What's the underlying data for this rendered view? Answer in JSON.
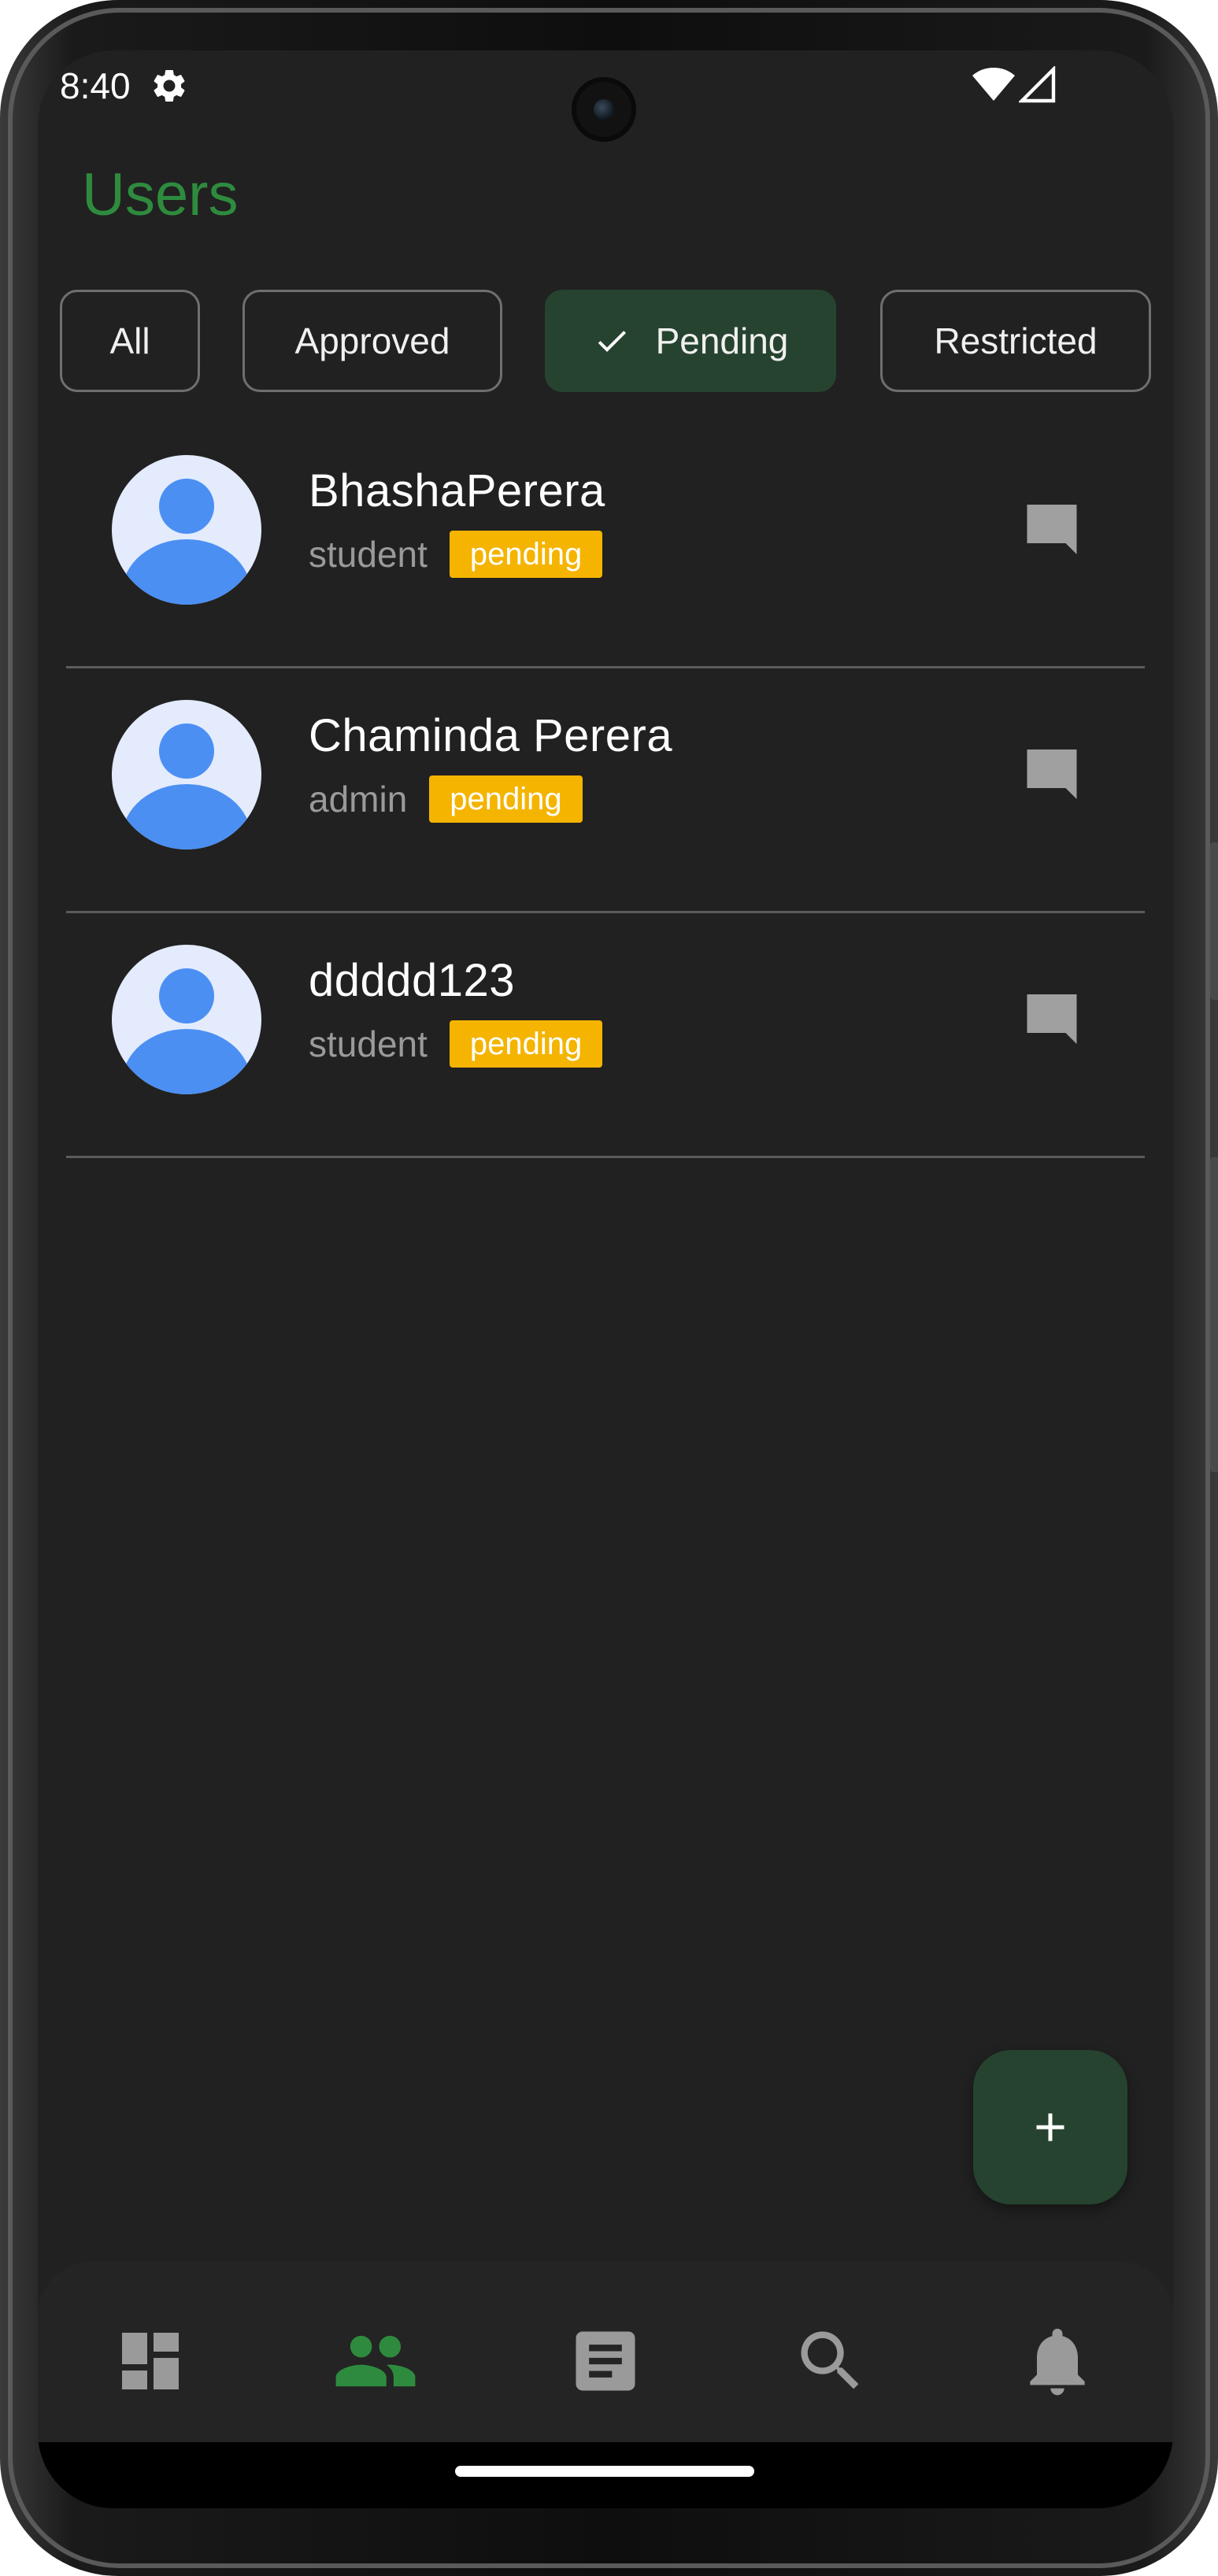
{
  "status_bar": {
    "time": "8:40",
    "icons": [
      "gear-icon",
      "wifi-icon",
      "cellular-signal-icon"
    ]
  },
  "app": {
    "title": "Users",
    "title_color": "#2e8b3e"
  },
  "filters": {
    "chips": [
      {
        "label": "All",
        "selected": false
      },
      {
        "label": "Approved",
        "selected": false
      },
      {
        "label": "Pending",
        "selected": true
      },
      {
        "label": "Restricted",
        "selected": false
      }
    ],
    "selected_color": "#26432f"
  },
  "users": [
    {
      "name": "BhashaPerera",
      "role": "student",
      "status": "pending"
    },
    {
      "name": "Chaminda Perera",
      "role": "admin",
      "status": "pending"
    },
    {
      "name": "ddddd123",
      "role": "student",
      "status": "pending"
    }
  ],
  "badge_color": "#f4b400",
  "fab": {
    "icon": "plus-icon"
  },
  "bottom_nav": {
    "items": [
      {
        "icon": "dashboard-icon",
        "active": false
      },
      {
        "icon": "people-icon",
        "active": true
      },
      {
        "icon": "article-icon",
        "active": false
      },
      {
        "icon": "search-icon",
        "active": false
      },
      {
        "icon": "notifications-icon",
        "active": false
      }
    ],
    "active_color": "#2e8b3e",
    "inactive_color": "#9a9a9a"
  }
}
